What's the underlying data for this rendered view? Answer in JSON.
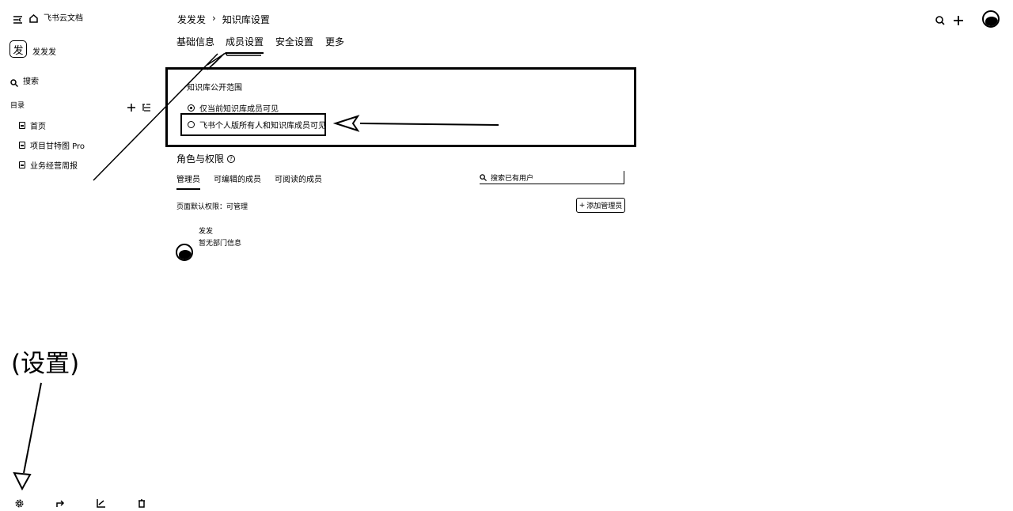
{
  "sidebar": {
    "app_name": "飞书云文档",
    "space_avatar_char": "发",
    "space_name": "发发发",
    "search_label": "搜索",
    "directory_label": "目录",
    "items": [
      {
        "label": "首页"
      },
      {
        "label": "项目甘特图 Pro"
      },
      {
        "label": "业务经营周报"
      }
    ]
  },
  "header": {
    "breadcrumb_space": "发发发",
    "breadcrumb_sep": "›",
    "breadcrumb_page": "知识库设置"
  },
  "tabs": [
    {
      "label": "基础信息"
    },
    {
      "label": "成员设置",
      "active": true
    },
    {
      "label": "安全设置"
    },
    {
      "label": "更多"
    }
  ],
  "visibility": {
    "title": "知识库公开范围",
    "options": [
      {
        "label": "仅当前知识库成员可见",
        "checked": true
      },
      {
        "label": "飞书个人版所有人和知识库成员可见",
        "checked": false
      }
    ]
  },
  "roles": {
    "title": "角色与权限",
    "help_icon": "?",
    "subtabs": [
      {
        "label": "管理员",
        "active": true
      },
      {
        "label": "可编辑的成员"
      },
      {
        "label": "可阅读的成员"
      }
    ],
    "search_placeholder": "搜索已有用户",
    "page_default_permission": "页面默认权限：可管理",
    "add_admin_label": "添加管理员",
    "members": [
      {
        "name": "发发",
        "subtitle": "暂无部门信息"
      }
    ]
  },
  "annotation": {
    "settings_callout": "(设置)"
  }
}
